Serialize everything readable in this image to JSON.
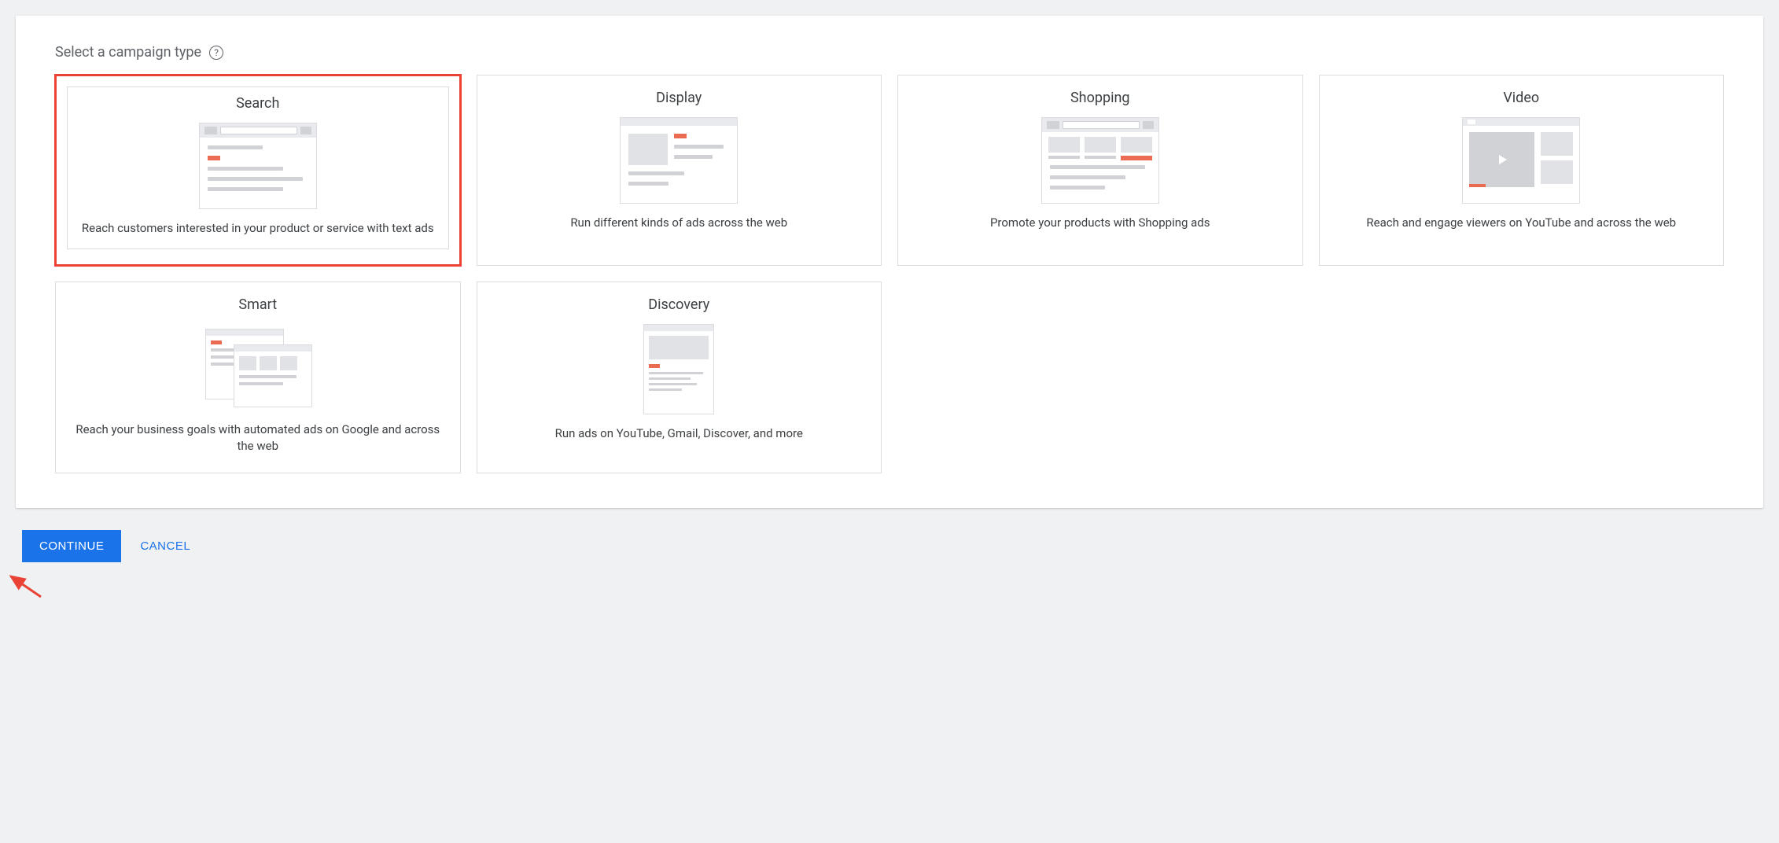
{
  "section_title": "Select a campaign type",
  "cards": [
    {
      "title": "Search",
      "desc": "Reach customers interested in your product or service with text ads",
      "selected": true
    },
    {
      "title": "Display",
      "desc": "Run different kinds of ads across the web",
      "selected": false
    },
    {
      "title": "Shopping",
      "desc": "Promote your products with Shopping ads",
      "selected": false
    },
    {
      "title": "Video",
      "desc": "Reach and engage viewers on YouTube and across the web",
      "selected": false
    },
    {
      "title": "Smart",
      "desc": "Reach your business goals with automated ads on Google and across the web",
      "selected": false
    },
    {
      "title": "Discovery",
      "desc": "Run ads on YouTube, Gmail, Discover, and more",
      "selected": false
    }
  ],
  "actions": {
    "continue_label": "Continue",
    "cancel_label": "Cancel"
  }
}
